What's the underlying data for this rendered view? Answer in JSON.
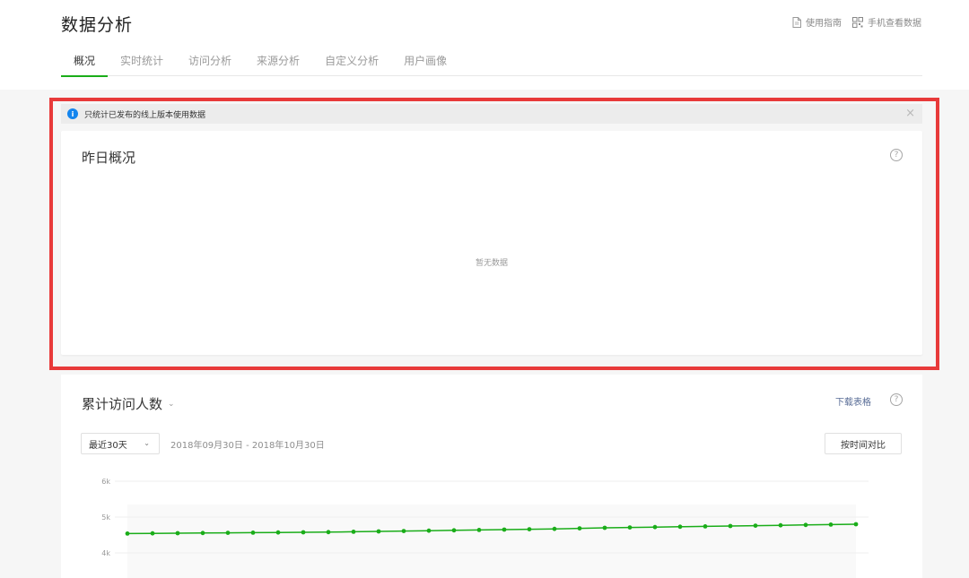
{
  "header": {
    "title": "数据分析",
    "links": [
      {
        "label": "使用指南",
        "icon": "document-icon"
      },
      {
        "label": "手机查看数据",
        "icon": "qr-code-icon"
      }
    ]
  },
  "tabs": [
    {
      "label": "概况",
      "active": true
    },
    {
      "label": "实时统计",
      "active": false
    },
    {
      "label": "访问分析",
      "active": false
    },
    {
      "label": "来源分析",
      "active": false
    },
    {
      "label": "自定义分析",
      "active": false
    },
    {
      "label": "用户画像",
      "active": false
    }
  ],
  "notice": {
    "text": "只统计已发布的线上版本使用数据",
    "icon": "info-icon",
    "close": "×"
  },
  "yesterday": {
    "title": "昨日概况",
    "empty_text": "暂无数据",
    "help": "?"
  },
  "visitors": {
    "title": "累计访问人数",
    "chevron": "⌄",
    "download_label": "下载表格",
    "help": "?",
    "range_select": "最近30天",
    "range_chevron": "⌄",
    "date_range": "2018年09月30日 - 2018年10月30日",
    "compare_label": "按时间对比"
  },
  "colors": {
    "accent": "#1aad19",
    "highlight_border": "#e83a3a",
    "info": "#1485ee",
    "link": "#576b95"
  },
  "chart_data": {
    "type": "line",
    "y_ticks": [
      "6k",
      "5k",
      "4k"
    ],
    "ylim": [
      4000,
      6000
    ],
    "grid": true,
    "series": [
      {
        "values": [
          4540,
          4545,
          4550,
          4555,
          4560,
          4565,
          4570,
          4575,
          4580,
          4590,
          4600,
          4610,
          4620,
          4630,
          4640,
          4650,
          4660,
          4670,
          4685,
          4700,
          4710,
          4720,
          4730,
          4740,
          4750,
          4760,
          4770,
          4780,
          4790,
          4800
        ]
      }
    ]
  }
}
